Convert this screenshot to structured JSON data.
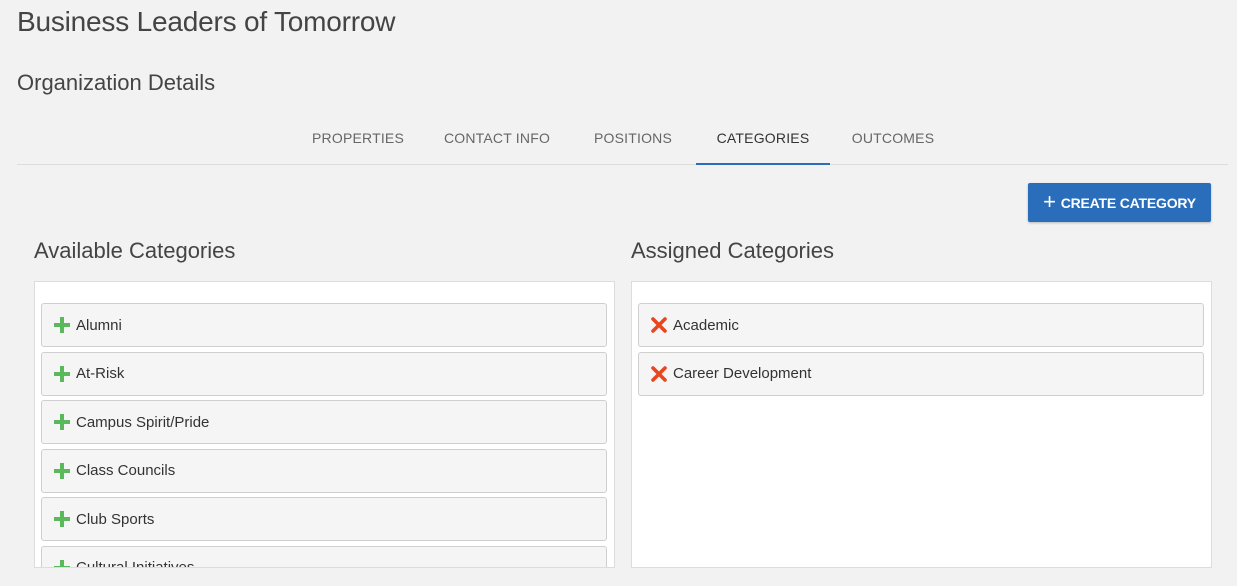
{
  "header": {
    "org_name": "Business Leaders of Tomorrow",
    "section_title": "Organization Details"
  },
  "tabs": [
    {
      "label": "PROPERTIES",
      "active": false
    },
    {
      "label": "CONTACT INFO",
      "active": false
    },
    {
      "label": "POSITIONS",
      "active": false
    },
    {
      "label": "CATEGORIES",
      "active": true
    },
    {
      "label": "OUTCOMES",
      "active": false
    }
  ],
  "toolbar": {
    "create_label": "CREATE CATEGORY",
    "create_icon": "plus-icon"
  },
  "available": {
    "title": "Available Categories",
    "item_icon": "plus-icon",
    "items": [
      "Alumni",
      "At-Risk",
      "Campus Spirit/Pride",
      "Class Councils",
      "Club Sports",
      "Cultural Initiatives"
    ]
  },
  "assigned": {
    "title": "Assigned Categories",
    "item_icon": "remove-x-icon",
    "items": [
      "Academic",
      "Career Development"
    ]
  },
  "colors": {
    "accent": "#2a6ebb",
    "add_green": "#5cb85c",
    "remove_red": "#e8461e"
  }
}
